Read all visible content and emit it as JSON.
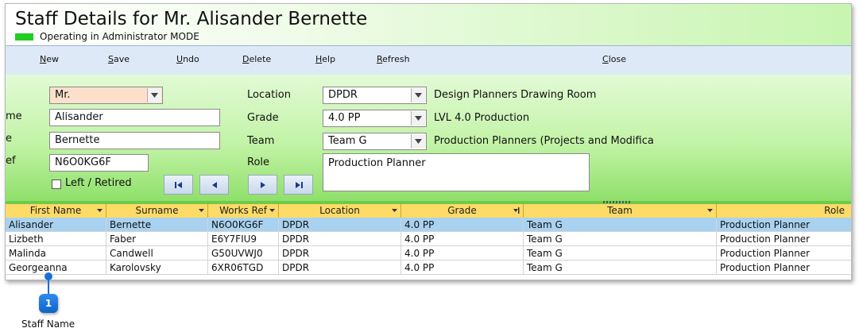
{
  "window": {
    "title": "Staff Details for Mr. Alisander Bernette",
    "mode_text": "Operating in Administrator MODE",
    "mode_color": "#22cc22"
  },
  "toolbar": {
    "new": {
      "u": "N",
      "rest": "ew"
    },
    "save": {
      "u": "S",
      "rest": "ave"
    },
    "undo": {
      "u": "U",
      "rest": "ndo"
    },
    "delete": {
      "u": "D",
      "rest": "elete"
    },
    "help": {
      "u": "H",
      "rest": "elp"
    },
    "refresh": {
      "u": "R",
      "rest": "efresh"
    },
    "close": {
      "u": "C",
      "rest": "lose"
    }
  },
  "form": {
    "labels": {
      "first_name": "me",
      "surname": "e",
      "works_ref": "ef"
    },
    "title_value": "Mr.",
    "first_name": "Alisander",
    "surname": "Bernette",
    "works_ref": "N6O0KG6F",
    "left_retired": "Left / Retired",
    "location_label": "Location",
    "location_value": "DPDR",
    "location_desc": "Design Planners Drawing Room",
    "grade_label": "Grade",
    "grade_value": "4.0 PP",
    "grade_desc": "LVL 4.0 Production",
    "team_label": "Team",
    "team_value": "Team G",
    "team_desc": "Production Planners (Projects and Modifica",
    "role_label": "Role",
    "role_value": "Production Planner"
  },
  "grid": {
    "headers": [
      "First Name",
      "Surname",
      "Works Ref",
      "Location",
      "Grade",
      "Team",
      "Role"
    ],
    "rows": [
      [
        "Alisander",
        "Bernette",
        "N6O0KG6F",
        "DPDR",
        "4.0 PP",
        "Team G",
        "Production Planner"
      ],
      [
        "Lizbeth",
        "Faber",
        "E6Y7FIU9",
        "DPDR",
        "4.0 PP",
        "Team G",
        "Production Planner"
      ],
      [
        "Malinda",
        "Candwell",
        "G50UVWJ0",
        "DPDR",
        "4.0 PP",
        "Team G",
        "Production Planner"
      ],
      [
        "Georgeanna",
        "Karolovsky",
        "6XR06TGD",
        "DPDR",
        "4.0 PP",
        "Team G",
        "Production Planner"
      ]
    ],
    "selected_row": 0
  },
  "callout": {
    "number": "1",
    "caption": "Staff Name"
  },
  "colors": {
    "header_row": "#fddb67",
    "selected_row": "#a9d2f0",
    "form_green": "#c2f3a6",
    "toolbar": "#dde9f7"
  }
}
